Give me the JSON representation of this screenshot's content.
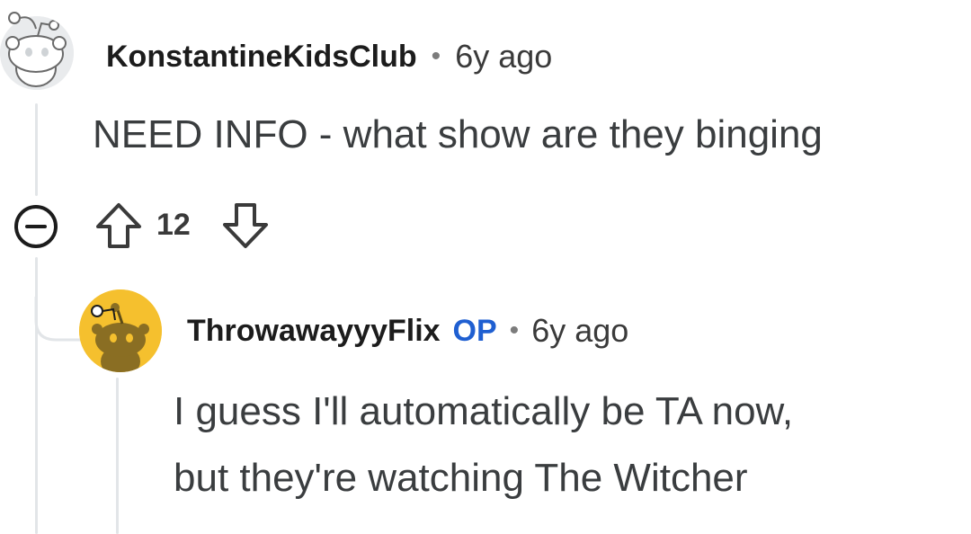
{
  "comment": {
    "author": "KonstantineKidsClub",
    "separator": "•",
    "time": "6y ago",
    "text": "NEED INFO - what show are they binging",
    "score": "12",
    "icons": {
      "avatar": "snoo-avatar-gray",
      "collapse": "collapse-minus-icon",
      "upvote": "upvote-arrow-icon",
      "downvote": "downvote-arrow-icon"
    }
  },
  "reply": {
    "author": "ThrowawayyyFlix",
    "op_badge": "OP",
    "separator": "•",
    "time": "6y ago",
    "text_line1": "I guess I'll automatically be TA now,",
    "text_line2": "but they're watching The Witcher",
    "icons": {
      "avatar": "snoo-avatar-yellow"
    }
  },
  "colors": {
    "op_badge": "#1f5fd1",
    "thread_line": "#e2e5e8",
    "reply_avatar_bg": "#f5c02e"
  }
}
